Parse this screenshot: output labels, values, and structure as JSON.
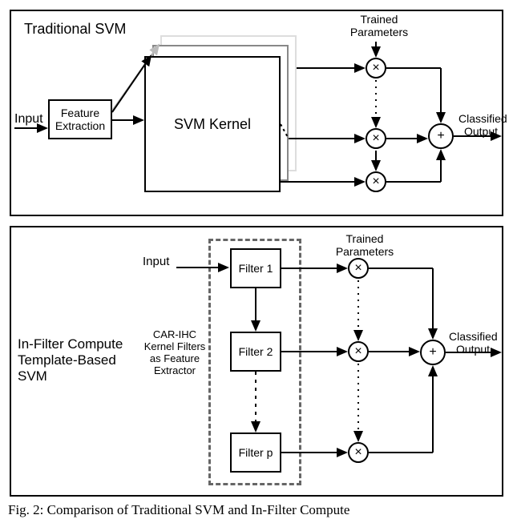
{
  "top": {
    "title": "Traditional SVM",
    "input": "Input",
    "feature": "Feature\nExtraction",
    "kernel": "SVM Kernel",
    "params": "Trained\nParameters",
    "output": "Classified\nOutput"
  },
  "bottom": {
    "title": "In-Filter Compute\nTemplate-Based\nSVM",
    "input": "Input",
    "filters": [
      "Filter 1",
      "Filter 2",
      "Filter p"
    ],
    "extractor": "CAR-IHC\nKernel Filters\nas Feature\nExtractor",
    "params": "Trained\nParameters",
    "output": "Classified\nOutput"
  },
  "caption": "Fig. 2: Comparison of Traditional SVM and In-Filter Compute"
}
